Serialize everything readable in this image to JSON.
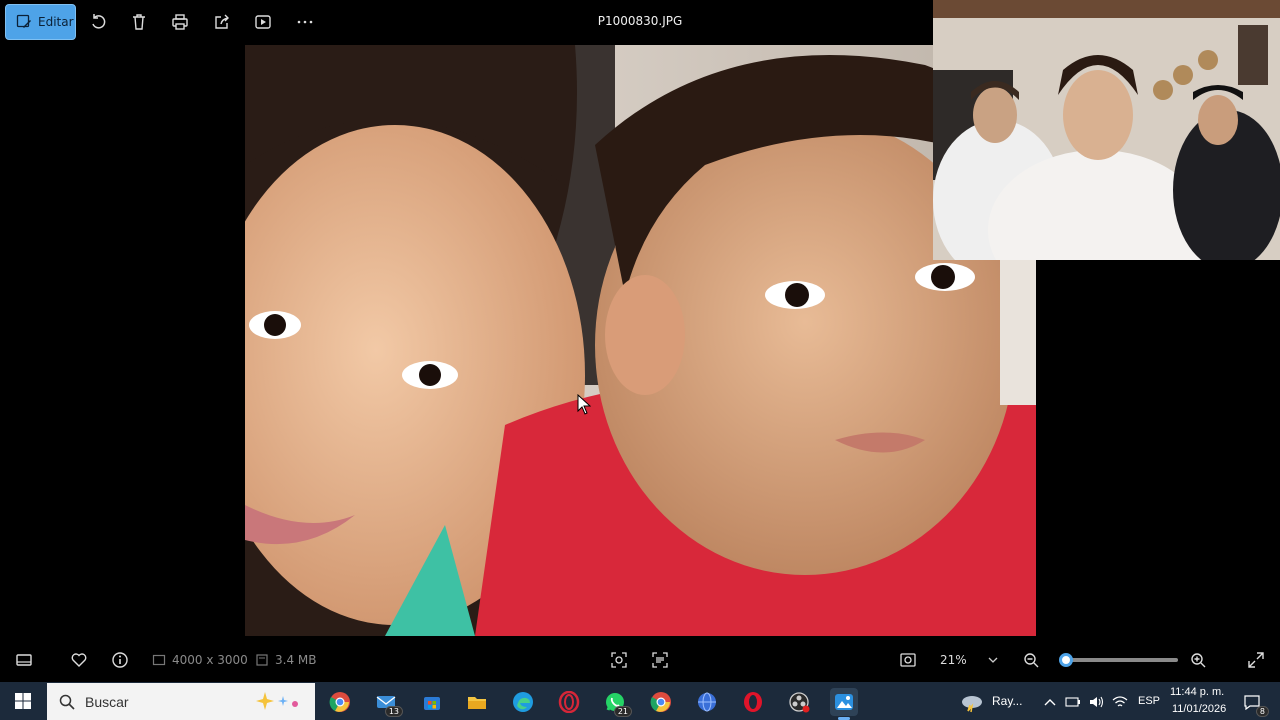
{
  "toolbar": {
    "edit_label": "Editar",
    "file_title": "P1000830.JPG",
    "icons": [
      "rotate-icon",
      "delete-icon",
      "print-icon",
      "share-icon",
      "slideshow-icon",
      "more-icon"
    ]
  },
  "bottombar": {
    "dimensions": "4000 x 3000",
    "file_size": "3.4 MB",
    "zoom_label": "21%",
    "zoom_level": 0.05
  },
  "taskbar": {
    "search_placeholder": "Buscar",
    "mail_badge": "13",
    "whatsapp_badge": "21",
    "weather_label": "Ray...",
    "language": "ESP",
    "time": "11:44 p. m.",
    "date": "11/01/2026",
    "notification_count": "8"
  },
  "colors": {
    "accent": "#4ea3e8",
    "taskbar_bg": "#1c2a3b",
    "app_bg": "#000000",
    "shirt_red": "#d8283a"
  }
}
